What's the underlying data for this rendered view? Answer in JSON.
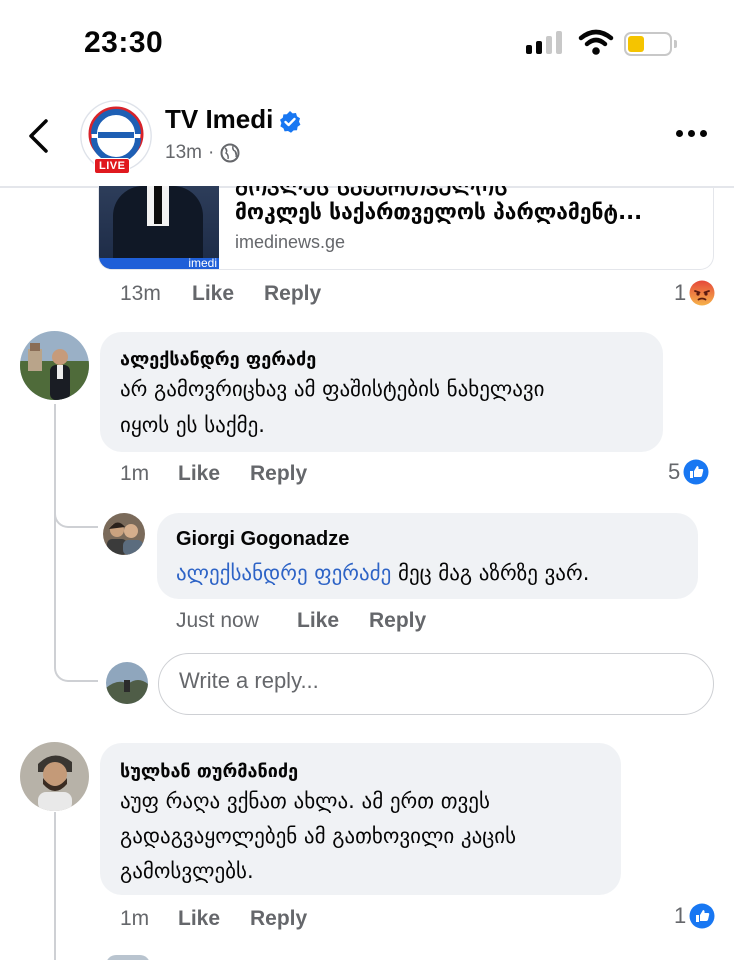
{
  "status_bar": {
    "time": "23:30",
    "battery_color": "#f5c400"
  },
  "header": {
    "page_name": "TV Imedi",
    "live_badge": "LIVE",
    "time_ago": "13m",
    "separator": "·",
    "audience_icon": "globe-icon",
    "back_icon": "chevron-left-icon",
    "more_icon": "more-dots-icon"
  },
  "link_card": {
    "title_clipped": "ᲛᲝᲙᲚᲔᲡ ᲡᲐᲥᲐᲠᲗᲕᲔᲚᲝᲡ",
    "title": "მოკლეს საქართველოს პარლამენტ...",
    "domain": "imedinews.ge",
    "thumb_watermark": "imedi"
  },
  "post_meta": {
    "time": "13m",
    "like": "Like",
    "reply": "Reply",
    "reaction_count": "1",
    "reaction_type": "angry"
  },
  "comments": [
    {
      "author": "ალექსანდრე ფერაძე",
      "lines": [
        "არ გამოვრიცხავ ამ ფაშისტების ნახელავი",
        "იყოს ეს საქმე."
      ],
      "time": "1m",
      "like": "Like",
      "reply": "Reply",
      "reaction_count": "5",
      "reaction_type": "like",
      "replies": [
        {
          "author": "Giorgi Gogonadze",
          "mention": "ალექსანდრე ფერაძე",
          "text": "მეც მაგ აზრზე ვარ.",
          "time": "Just now",
          "like": "Like",
          "reply": "Reply"
        }
      ]
    },
    {
      "author": "სულხან თურმანიძე",
      "lines": [
        "აუფ რაღა ვქნათ ახლა.  ამ ერთ თვეს",
        "გადაგვაყოლებენ ამ გათხოვილი კაცის",
        "გამოსვლებს."
      ],
      "time": "1m",
      "like": "Like",
      "reply": "Reply",
      "reaction_count": "1",
      "reaction_type": "like"
    }
  ],
  "reply_input": {
    "placeholder": "Write a reply..."
  },
  "colors": {
    "brand_blue": "#1877f2",
    "mention_blue": "#2d63c6",
    "meta_gray": "#65676b",
    "bubble_gray": "#f0f2f5",
    "angry_orange": "#f0703b"
  }
}
